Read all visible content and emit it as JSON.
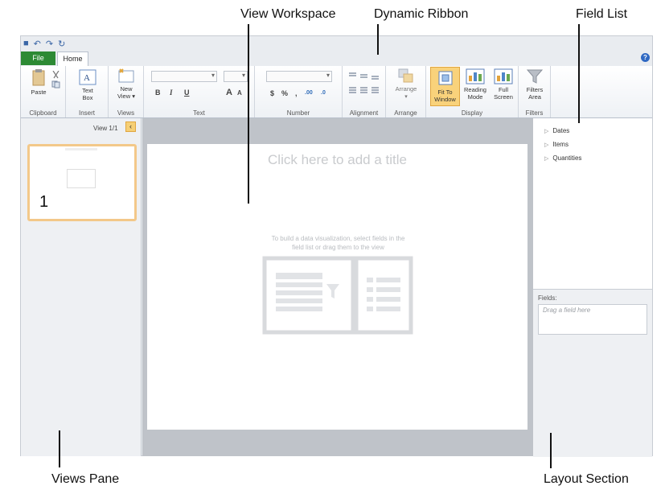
{
  "callouts": {
    "view_workspace": "View Workspace",
    "dynamic_ribbon": "Dynamic Ribbon",
    "field_list": "Field List",
    "views_pane": "Views Pane",
    "layout_section": "Layout Section"
  },
  "tabs": {
    "file": "File",
    "home": "Home"
  },
  "help_icon": "?",
  "ribbon": {
    "groups": {
      "clipboard": "Clipboard",
      "insert": "Insert",
      "views": "Views",
      "text": "Text",
      "number": "Number",
      "alignment": "Alignment",
      "arrange": "Arrange",
      "display": "Display",
      "filters": "Filters"
    },
    "buttons": {
      "paste": "Paste",
      "text_box_1": "Text",
      "text_box_2": "Box",
      "new_view_1": "New",
      "new_view_2": "View ▾",
      "bold": "B",
      "italic": "I",
      "underline": "U",
      "grow_font": "A",
      "shrink_font": "A",
      "currency": "$",
      "percent": "%",
      "comma": ",",
      "inc_decimal": ".00",
      "dec_decimal": ".0",
      "arrange": "Arrange",
      "fit_1": "Fit To",
      "fit_2": "Window",
      "reading_1": "Reading",
      "reading_2": "Mode",
      "full_1": "Full",
      "full_2": "Screen",
      "filters_1": "Filters",
      "filters_2": "Area"
    },
    "colors": {
      "active_button": "#f9d27b",
      "file_tab": "#2d8a34"
    }
  },
  "views_pane": {
    "view_label": "View 1/1",
    "collapse_glyph": "‹",
    "thumbnail_number": "1"
  },
  "workspace": {
    "title_placeholder": "Click here to add a title",
    "hint_line1": "To build a data visualization, select fields in the",
    "hint_line2": "field list or drag them to the view"
  },
  "field_list": {
    "items": [
      "Dates",
      "Items",
      "Quantities"
    ]
  },
  "layout_section": {
    "fields_label": "Fields:",
    "drop_placeholder": "Drag a field here"
  }
}
